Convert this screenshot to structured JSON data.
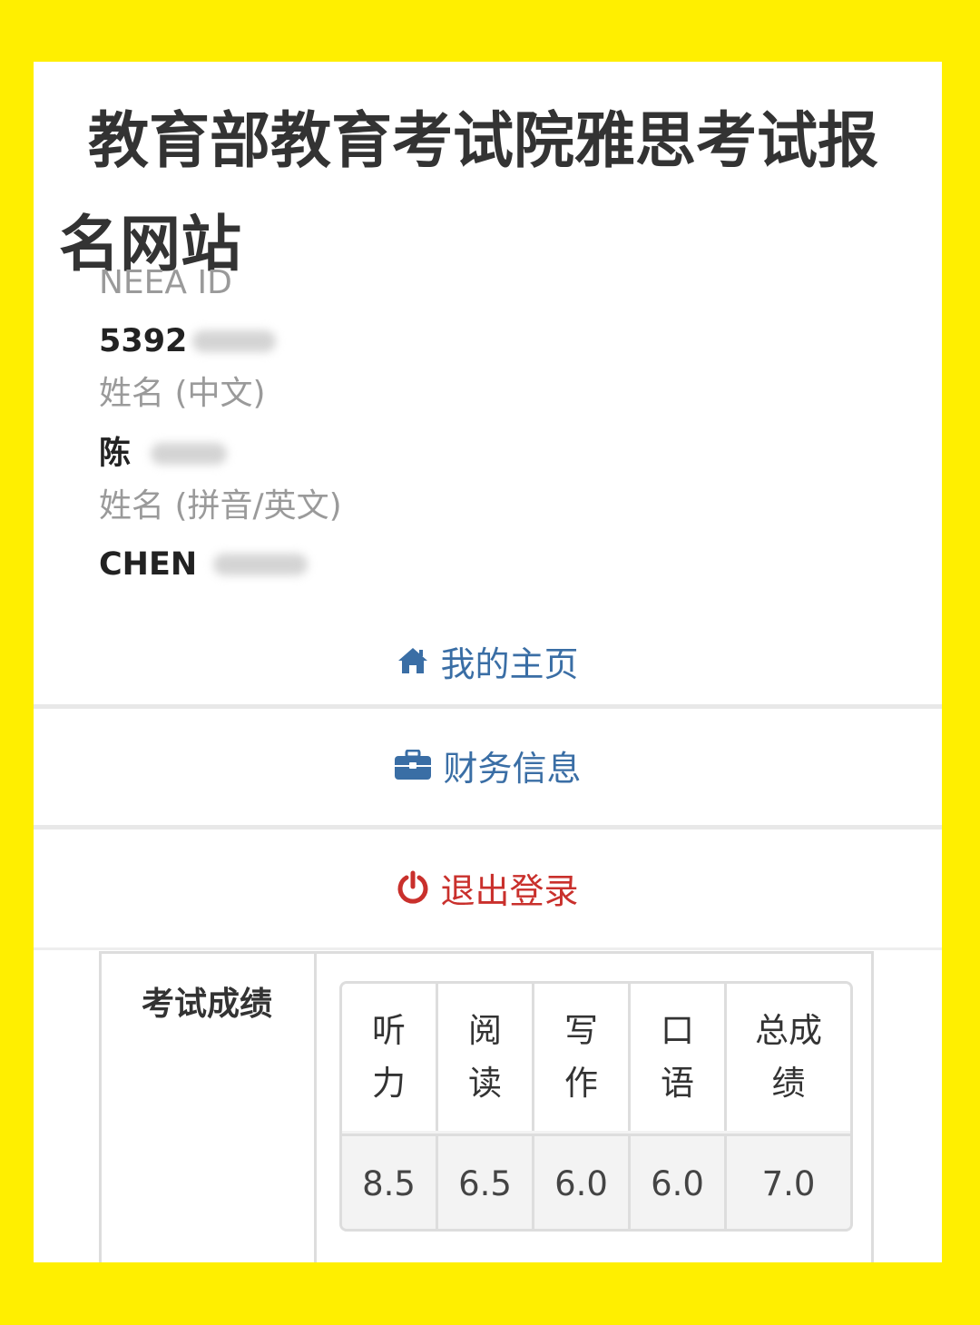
{
  "site": {
    "title": "教育部教育考试院雅思考试报名网站"
  },
  "profile": {
    "neea_id_label": "NEEA ID",
    "neea_id_value": "5392",
    "name_cn_label": "姓名 (中文)",
    "name_cn_value": "陈",
    "name_en_label": "姓名 (拼音/英文)",
    "name_en_value": "CHEN"
  },
  "nav": {
    "home": "我的主页",
    "finance": "财务信息",
    "logout": "退出登录"
  },
  "colors": {
    "background": "#FFEF00",
    "link": "#3a6ea5",
    "logout": "#c9302c"
  },
  "scores": {
    "label": "考试成绩",
    "headers": [
      "听力",
      "阅读",
      "写作",
      "口语",
      "总成绩"
    ],
    "values": [
      "8.5",
      "6.5",
      "6.0",
      "6.0",
      "7.0"
    ]
  }
}
